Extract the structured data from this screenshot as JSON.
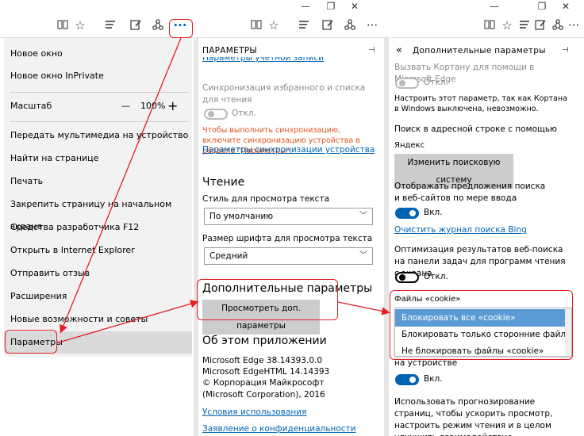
{
  "window_controls": {
    "minimize": "—",
    "maximize": "❐",
    "close": "✕"
  },
  "menu": {
    "new_window": "Новое окно",
    "new_inprivate": "Новое окно InPrivate",
    "zoom_label": "Масштаб",
    "zoom_minus": "—",
    "zoom_value": "100%",
    "zoom_plus": "+",
    "cast": "Передать мультимедиа на устройство",
    "find": "Найти на странице",
    "print": "Печать",
    "pin": "Закрепить страницу на начальном экране",
    "devtools": "Средства разработчика F12",
    "open_ie": "Открыть в Internet Explorer",
    "feedback": "Отправить отзыв",
    "extensions": "Расширения",
    "whats_new": "Новые возможности и советы",
    "settings": "Параметры"
  },
  "settings": {
    "title": "ПАРАМЕТРЫ",
    "account_link": "Параметры учетной записи",
    "sync_label": "Синхронизация избранного и списка для чтения",
    "sync_state": "Откл.",
    "sync_note": "Чтобы выполнить синхронизацию, включите синхронизацию устройства в разделе \"Параметры\".",
    "sync_link": "Параметры синхронизации устройства",
    "reading_heading": "Чтение",
    "reading_style_label": "Стиль для просмотра текста",
    "reading_style_value": "По умолчанию",
    "font_size_label": "Размер шрифта для просмотра текста",
    "font_size_value": "Средний",
    "advanced_heading": "Дополнительные параметры",
    "advanced_button": "Просмотреть доп. параметры",
    "about_heading": "Об этом приложении",
    "version_edge": "Microsoft Edge 38.14393.0.0",
    "version_html": "Microsoft EdgeHTML 14.14393",
    "copyright": "© Корпорация Майкрософт (Microsoft Corporation), 2016",
    "terms_link": "Условия использования",
    "privacy_link": "Заявление о конфиденциальности"
  },
  "advanced": {
    "back": "«",
    "title": "Дополнительные параметры",
    "cortana_label": "Вызвать Кортану для помощи в Microsoft Edge",
    "cortana_state": "Откл.",
    "cortana_note": "Настроить этот параметр, так как Кортана в Windows выключена, невозможно.",
    "search_label": "Поиск в адресной строке с помощью",
    "search_engine": "Яндекс",
    "change_search_button": "Изменить поисковую систему",
    "suggestions_label": "Отображать предложения поиска и веб-сайтов по мере ввода",
    "suggestions_state": "Вкл.",
    "clear_bing_link": "Очистить журнал поиска Bing",
    "optimize_label": "Оптимизация результатов веб-поиска на панели задач для программ чтения с экрана",
    "optimize_state": "Откл.",
    "cookies_label": "Файлы «cookie»",
    "cookie_options": [
      "Блокировать все «cookie»",
      "Блокировать только сторонние файлы cookie",
      "Не блокировать файлы «cookie»"
    ],
    "protected_media_label": "защищенных файлов мультимедиа на устройстве",
    "protected_media_state": "Вкл.",
    "predict_label": "Использовать прогнозирование страниц, чтобы ускорить просмотр, настроить режим чтения и в целом улучшить взаимодействие"
  },
  "colors": {
    "accent": "#0063b1",
    "annotation": "#e51c23",
    "warning": "#e0531f"
  }
}
